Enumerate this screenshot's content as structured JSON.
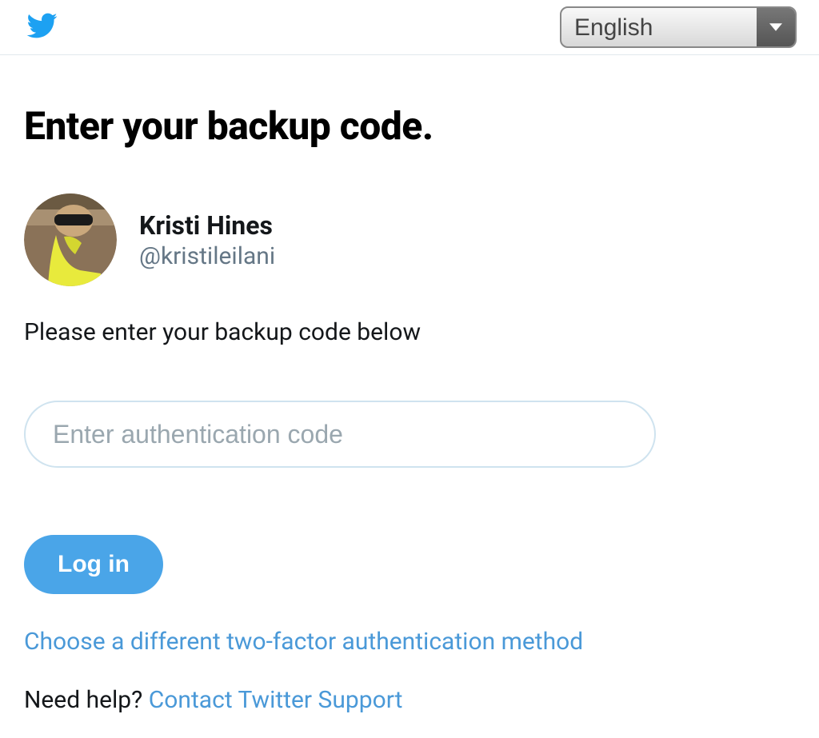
{
  "header": {
    "language": "English"
  },
  "page": {
    "title": "Enter your backup code.",
    "instruction": "Please enter your backup code below",
    "code_placeholder": "Enter authentication code",
    "login_button": "Log in",
    "alt_method": "Choose a different two-factor authentication method",
    "help_prefix": "Need help? ",
    "help_link": "Contact Twitter Support"
  },
  "user": {
    "name": "Kristi Hines",
    "handle": "@kristileilani"
  }
}
